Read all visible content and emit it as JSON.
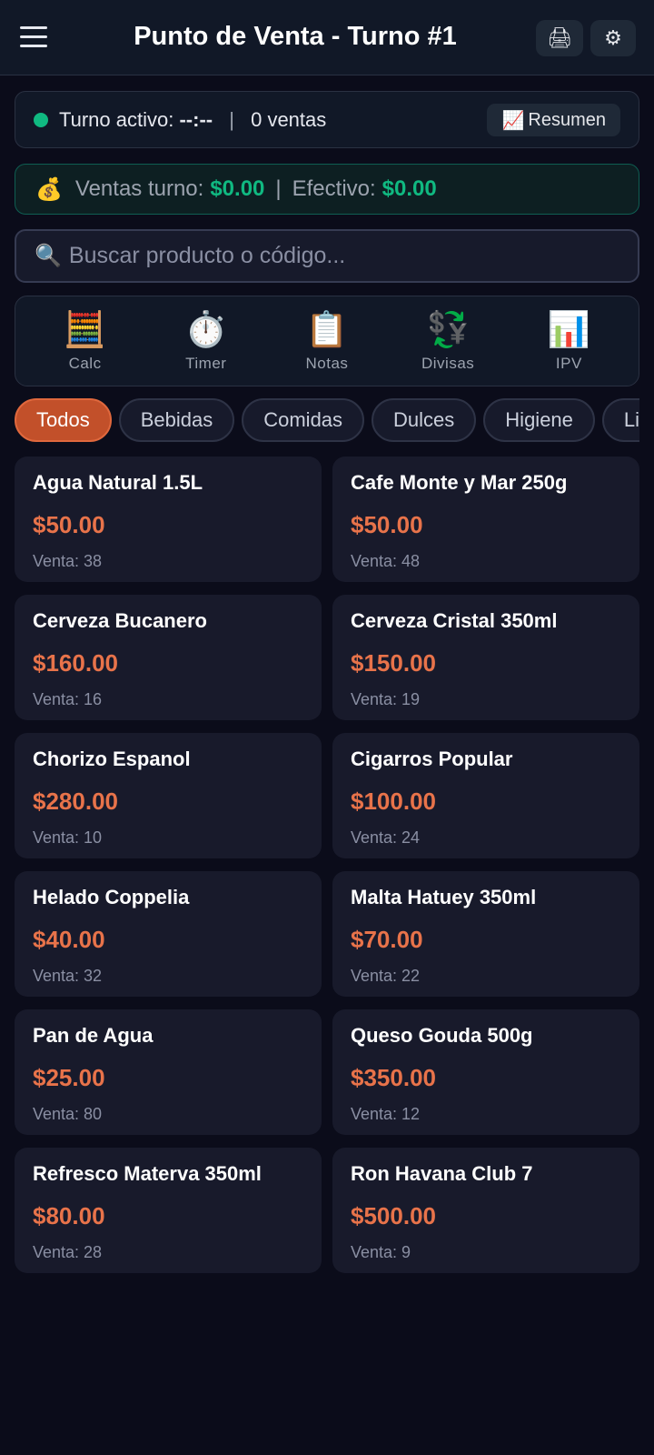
{
  "header": {
    "title": "Punto de Venta - Turno #1",
    "menu_icon": "hamburger-icon",
    "print_icon": "🖨",
    "settings_icon": "⚙"
  },
  "shift": {
    "label": "Turno activo:",
    "time": "--:--",
    "sales_count": "0 ventas",
    "summary_icon": "📈",
    "summary_label": "Resumen",
    "status_color": "#10b981"
  },
  "totals": {
    "icon": "💰",
    "sales_label": "Ventas turno:",
    "sales_value": "$0.00",
    "cash_label": "Efectivo:",
    "cash_value": "$0.00"
  },
  "search": {
    "icon": "🔍",
    "placeholder": "Buscar producto o código..."
  },
  "tools": [
    {
      "icon": "🧮",
      "label": "Calc"
    },
    {
      "icon": "⏱️",
      "label": "Timer"
    },
    {
      "icon": "📋",
      "label": "Notas"
    },
    {
      "icon": "💱",
      "label": "Divisas"
    },
    {
      "icon": "📊",
      "label": "IPV"
    }
  ],
  "categories": [
    "Todos",
    "Bebidas",
    "Comidas",
    "Dulces",
    "Higiene",
    "Limpieza"
  ],
  "active_category": "Todos",
  "accent_color": "#c2502a",
  "price_color": "#e8734a",
  "products": [
    {
      "name": "Agua Natural 1.5L",
      "price": "$50.00",
      "sold": "Venta: 38"
    },
    {
      "name": "Cafe Monte y Mar 250g",
      "price": "$50.00",
      "sold": "Venta: 48"
    },
    {
      "name": "Cerveza Bucanero",
      "price": "$160.00",
      "sold": "Venta: 16"
    },
    {
      "name": "Cerveza Cristal 350ml",
      "price": "$150.00",
      "sold": "Venta: 19"
    },
    {
      "name": "Chorizo Espanol",
      "price": "$280.00",
      "sold": "Venta: 10"
    },
    {
      "name": "Cigarros Popular",
      "price": "$100.00",
      "sold": "Venta: 24"
    },
    {
      "name": "Helado Coppelia",
      "price": "$40.00",
      "sold": "Venta: 32"
    },
    {
      "name": "Malta Hatuey 350ml",
      "price": "$70.00",
      "sold": "Venta: 22"
    },
    {
      "name": "Pan de Agua",
      "price": "$25.00",
      "sold": "Venta: 80"
    },
    {
      "name": "Queso Gouda 500g",
      "price": "$350.00",
      "sold": "Venta: 12"
    },
    {
      "name": "Refresco Materva 350ml",
      "price": "$80.00",
      "sold": "Venta: 28"
    },
    {
      "name": "Ron Havana Club 7",
      "price": "$500.00",
      "sold": "Venta: 9"
    }
  ]
}
